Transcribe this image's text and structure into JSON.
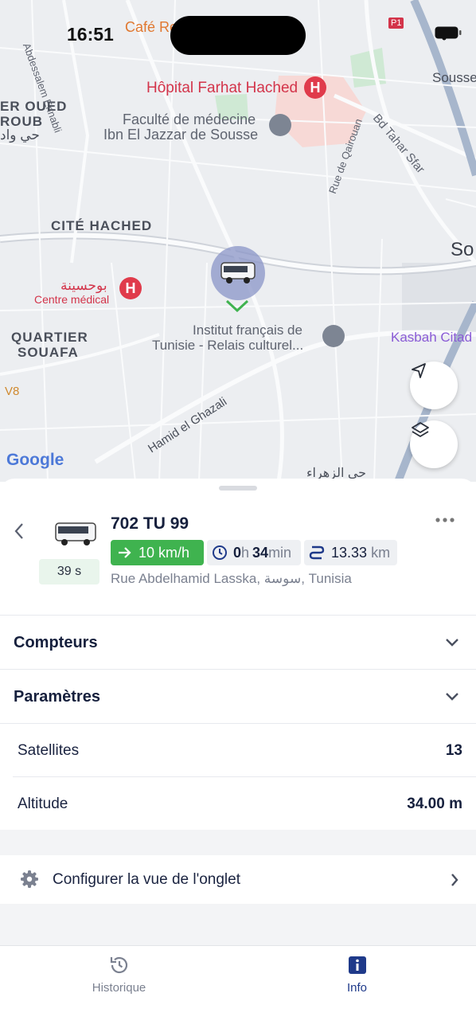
{
  "status_bar": {
    "time": "16:51"
  },
  "map": {
    "labels": {
      "cafe": "Café Re",
      "hopital": "Hôpital Farhat Hached",
      "faculte_1": "Faculté de médecine",
      "faculte_2": "Ibn El Jazzar de Sousse",
      "oued_1": "ER OUED",
      "oued_2": "ROUB",
      "oued_ar": "حي واد",
      "abdessalem": "Abdessalem Ennabli",
      "cite_hached": "CITÉ HACHED",
      "rue_qairouan": "Rue de Qairouan",
      "bd_tahar": "Bd Tahar Sfar",
      "sousse_top": "Sousse",
      "sousse_mid": "So",
      "centre_ar": "بوحسينة",
      "centre_medical": "Centre médical",
      "quartier_1": "QUARTIER",
      "quartier_2": "SOUAFA",
      "institut_1": "Institut français de",
      "institut_2": "Tunisie - Relais culturel...",
      "kasbah": "Kasbah Citad",
      "v8": "V8",
      "hamid": "Hamid el Ghazali",
      "zahra_ar": "حي الزهراء",
      "google": "Google",
      "p1": "P1"
    }
  },
  "vehicle": {
    "plate": "702 TU 99",
    "last_update": "39 s",
    "speed": "10 km/h",
    "duration_h": "0",
    "duration_h_unit": "h",
    "duration_m": "34",
    "duration_m_unit": "min",
    "distance": "13.33",
    "distance_unit": "km",
    "address": "Rue Abdelhamid Lasska, سوسة, Tunisia"
  },
  "sections": {
    "compteurs": "Compteurs",
    "parametres": "Paramètres"
  },
  "params": {
    "satellites_label": "Satellites",
    "satellites_value": "13",
    "altitude_label": "Altitude",
    "altitude_value": "34.00 m"
  },
  "config": {
    "label": "Configurer la vue de l'onglet"
  },
  "tabs": {
    "historique": "Historique",
    "info": "Info"
  },
  "colors": {
    "accent": "#1f3a8a",
    "speed_green": "#3fb34f",
    "chip_bg": "#eef0f3",
    "hospital_red": "#e03b4b"
  }
}
